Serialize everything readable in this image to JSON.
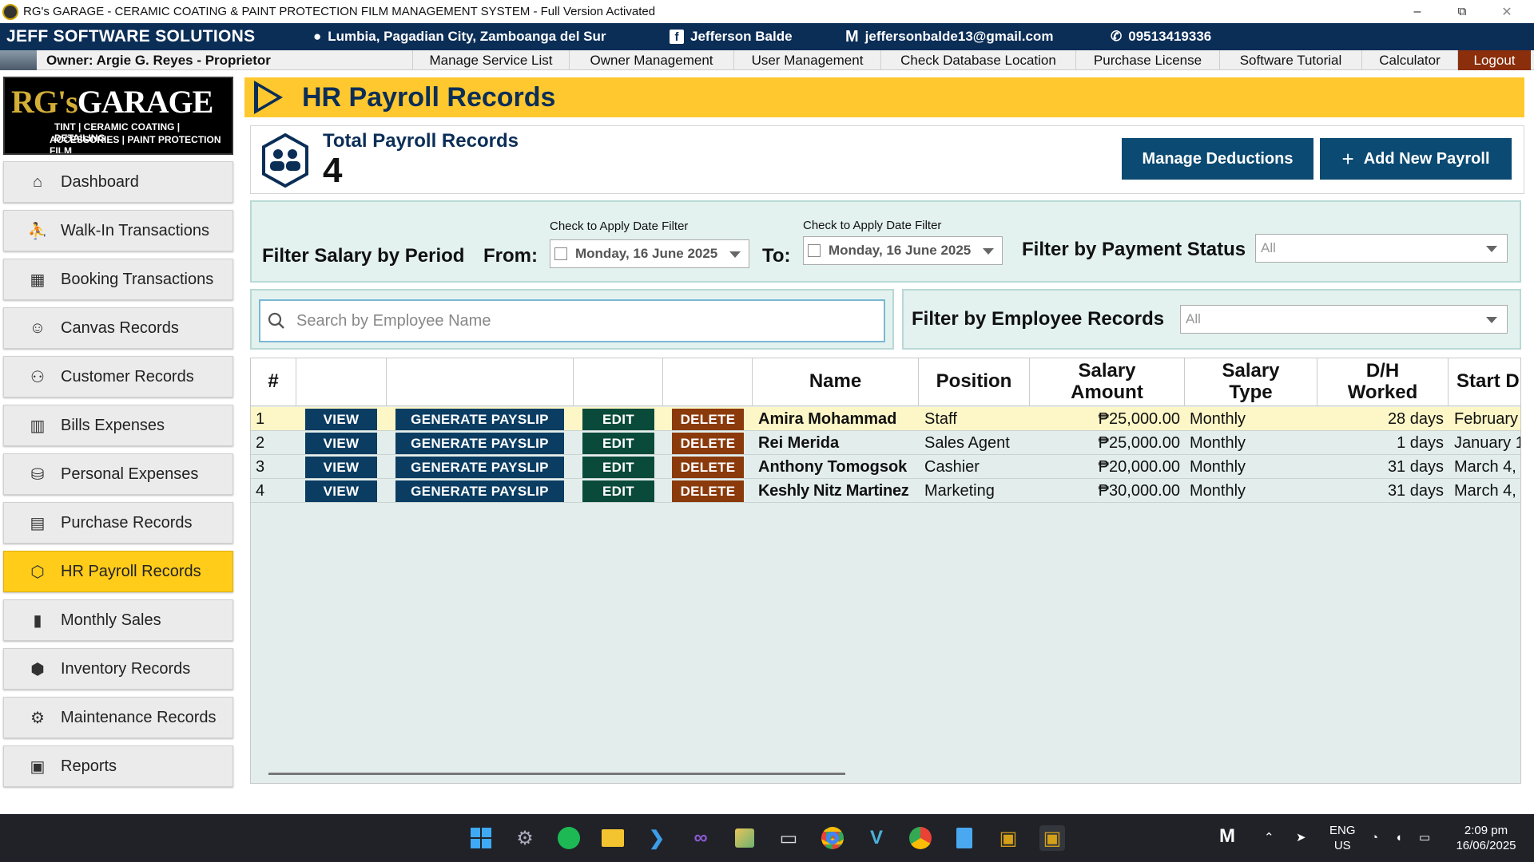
{
  "window": {
    "title": "RG's GARAGE - CERAMIC COATING & PAINT PROTECTION FILM MANAGEMENT SYSTEM - Full Version Activated",
    "minimize": "–",
    "maximize": "⧉",
    "close": "✕"
  },
  "infobar": {
    "brand": "JEFF SOFTWARE SOLUTIONS",
    "location": "Lumbia, Pagadian City, Zamboanga del Sur",
    "facebook": "Jefferson Balde",
    "email": "jeffersonbalde13@gmail.com",
    "phone": "09513419336"
  },
  "menubar": {
    "owner": "Owner: Argie G. Reyes - Proprietor",
    "items": [
      "Manage Service List",
      "Owner Management",
      "User Management",
      "Check Database Location",
      "Purchase License",
      "Software Tutorial",
      "Calculator",
      "Logout"
    ]
  },
  "logo": {
    "name_prefix": "RG's",
    "name_suffix": "GARAGE",
    "line1": "TINT | CERAMIC COATING | DETAILING",
    "line2": "ACCESSORIES | PAINT PROTECTION FILM"
  },
  "sidebar": {
    "items": [
      {
        "label": "Dashboard",
        "icon": "dashboard-icon",
        "glyph": "⌂"
      },
      {
        "label": "Walk-In Transactions",
        "icon": "walk-in-icon",
        "glyph": "⛹"
      },
      {
        "label": "Booking Transactions",
        "icon": "calendar-icon",
        "glyph": "▦"
      },
      {
        "label": "Canvas Records",
        "icon": "person-card-icon",
        "glyph": "☺"
      },
      {
        "label": "Customer Records",
        "icon": "users-icon",
        "glyph": "⚇"
      },
      {
        "label": "Bills Expenses",
        "icon": "bills-icon",
        "glyph": "▥"
      },
      {
        "label": "Personal Expenses",
        "icon": "wallet-icon",
        "glyph": "⛁"
      },
      {
        "label": "Purchase Records",
        "icon": "receipt-icon",
        "glyph": "▤"
      },
      {
        "label": "HR Payroll Records",
        "icon": "payroll-icon",
        "glyph": "⬡",
        "active": true
      },
      {
        "label": "Monthly Sales",
        "icon": "bar-chart-icon",
        "glyph": "▮"
      },
      {
        "label": "Inventory Records",
        "icon": "box-icon",
        "glyph": "⬢"
      },
      {
        "label": "Maintenance Records",
        "icon": "maintenance-icon",
        "glyph": "⚙"
      },
      {
        "label": "Reports",
        "icon": "reports-icon",
        "glyph": "▣"
      }
    ]
  },
  "page": {
    "title": "HR Payroll Records",
    "total_label": "Total Payroll Records",
    "total_count": "4",
    "manage_deductions": "Manage Deductions",
    "add_new_payroll": "Add New Payroll",
    "add_icon": "+"
  },
  "filters": {
    "period_label": "Filter Salary by Period",
    "from_label": "From:",
    "to_label": "To:",
    "date_hint": "Check to Apply Date Filter",
    "from_date": "Monday, 16 June 2025",
    "to_date": "Monday, 16 June 2025",
    "payment_status_label": "Filter by Payment Status",
    "payment_status_value": "All",
    "search_placeholder": "Search by Employee Name",
    "employee_records_label": "Filter by Employee Records",
    "employee_records_value": "All"
  },
  "table": {
    "headers": {
      "num": "#",
      "name": "Name",
      "position": "Position",
      "salary_amount_1": "Salary",
      "salary_amount_2": "Amount",
      "salary_type_1": "Salary",
      "salary_type_2": "Type",
      "dh_worked_1": "D/H",
      "dh_worked_2": "Worked",
      "start_date": "Start D"
    },
    "actions": {
      "view": "VIEW",
      "generate": "GENERATE PAYSLIP",
      "edit": "EDIT",
      "delete": "DELETE"
    },
    "rows": [
      {
        "num": "1",
        "name": "Amira Mohammad",
        "position": "Staff",
        "salary": "₱25,000.00",
        "type": "Monthly",
        "worked": "28 days",
        "start": "February"
      },
      {
        "num": "2",
        "name": "Rei Merida",
        "position": "Sales Agent",
        "salary": "₱25,000.00",
        "type": "Monthly",
        "worked": "1 days",
        "start": "January 1"
      },
      {
        "num": "3",
        "name": "Anthony Tomogsok",
        "position": "Cashier",
        "salary": "₱20,000.00",
        "type": "Monthly",
        "worked": "31 days",
        "start": "March 4,"
      },
      {
        "num": "4",
        "name": "Keshly Nitz Martinez",
        "position": "Marketing",
        "salary": "₱30,000.00",
        "type": "Monthly",
        "worked": "31 days",
        "start": "March 4,"
      }
    ]
  },
  "taskbar": {
    "language": "ENG",
    "region": "US",
    "time": "2:09 pm",
    "date": "16/06/2025"
  },
  "colors": {
    "navy": "#0b2e57",
    "header_yellow": "#ffc82e",
    "active_yellow": "#ffcc1a",
    "edit_green": "#0a4a3a",
    "delete_brown": "#8b3a0b",
    "filter_bg": "#e3f2ef"
  }
}
